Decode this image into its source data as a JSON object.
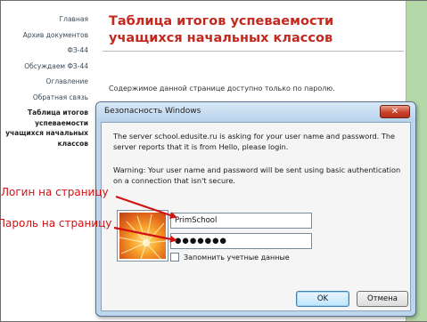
{
  "sidebar": {
    "items": [
      {
        "label": "Главная"
      },
      {
        "label": "Архив документов"
      },
      {
        "label": "ФЗ-44"
      },
      {
        "label": "Обсуждаем ФЗ-44"
      },
      {
        "label": "Оглавление"
      },
      {
        "label": "Обратная связь"
      },
      {
        "label": "Таблица итогов успеваемости учащихся начальных классов"
      }
    ]
  },
  "main": {
    "title": "Таблица итогов успеваемости учащихся начальных классов",
    "note": "Содержимое данной странице доступно только по паролю."
  },
  "dialog": {
    "title": "Безопасность Windows",
    "close_symbol": "✕",
    "message": "The server school.edusite.ru is asking for your user name and password. The server reports that it is from Hello, please login.",
    "warning": "Warning: Your user name and password will be sent using basic authentication on a connection that isn't secure.",
    "username_value": "PrimSchool",
    "password_value": "●●●●●●●",
    "remember_label": "Запомнить учетные данные",
    "ok_label": "OK",
    "cancel_label": "Отмена"
  },
  "annotations": {
    "login_label": "Логин на страницу",
    "password_label": "Пароль на страницу",
    "color": "#d01212"
  },
  "icons": {
    "avatar": "user-tile-icon",
    "close": "close-icon"
  }
}
